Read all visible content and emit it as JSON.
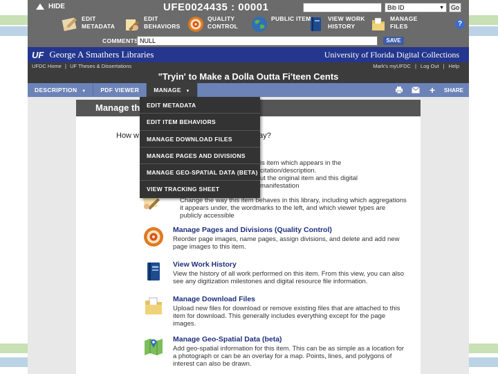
{
  "admin": {
    "hide_label": "HIDE",
    "item_id": "UFE0024435 : 00001",
    "search_value": "",
    "search_placeholder": "",
    "select_value": "Bib ID",
    "go_label": "Go",
    "tools": [
      {
        "label": "EDIT METADATA",
        "icon": "edit-metadata-icon"
      },
      {
        "label": "EDIT BEHAVIORS",
        "icon": "edit-behaviors-icon"
      },
      {
        "label": "QUALITY CONTROL",
        "icon": "quality-control-icon"
      },
      {
        "label": "PUBLIC ITEM",
        "icon": "globe-icon"
      },
      {
        "label": "VIEW WORK HISTORY",
        "icon": "book-icon"
      },
      {
        "label": "MANAGE FILES",
        "icon": "folder-icon"
      }
    ],
    "help_label": "?",
    "comments_label": "COMMENTS:",
    "comments_value": "NULL",
    "save_label": "SAVE"
  },
  "banner": {
    "logo": "UF",
    "library_name": "George A Smathers Libraries",
    "collections": "University of Florida Digital Collections"
  },
  "crumbs": {
    "home": "UFDC Home",
    "separator": "|",
    "theses": "UF Theses & Dissertations",
    "my_ufdc": "Mark's myUFDC",
    "logout": "Log Out",
    "help": "Help"
  },
  "item_title": "\"Tryin' to Make a Dolla Outta Fi'teen Cents",
  "menubar": {
    "description": "DESCRIPTION",
    "pdf_viewer": "PDF VIEWER",
    "manage": "MANAGE",
    "caret": "▼",
    "share": "SHARE"
  },
  "dropdown": [
    "EDIT METADATA",
    "EDIT ITEM BEHAVIORS",
    "MANAGE DOWNLOAD FILES",
    "MANAGE PAGES AND DIVISIONS",
    "MANAGE GEO-SPATIAL DATA (BETA)",
    "VIEW TRACKING SHEET"
  ],
  "content": {
    "manage_title": "Manage thi",
    "intro_start": "How w",
    "intro_end": "day?",
    "partial1_line1": "is item which appears in the citation/description.",
    "partial1_line2": "ut the original item and this digital manifestation",
    "partial2": "Change the way this item behaves in this library, including which aggregations it appears under, the wordmarks to the left, and which viewer types are publicly accessible",
    "entries": [
      {
        "title": "Manage Pages and Divisions (Quality Control)",
        "desc": "Reorder page images, name pages, assign divisions, and delete and add new page images to this item."
      },
      {
        "title": "View Work History",
        "desc": "View the history of all work performed on this item. From this view, you can also see any digitization milestones and digital resource file information."
      },
      {
        "title": "Manage Download Files",
        "desc": "Upload new files for download or remove existing files that are attached to this item for download. This generally includes everything except for the page images."
      },
      {
        "title": "Manage Geo-Spatial Data (beta)",
        "desc": "Add geo-spatial information for this item. This can be as simple as a location for a photograph or can be an overlay for a map. Points, lines, and polygons of interest can also be drawn."
      }
    ]
  },
  "colors": {
    "banner": "#24368d",
    "menubar": "#6c83b8",
    "admin_bar": "#6b6b6b",
    "link": "#1f2f7e"
  }
}
